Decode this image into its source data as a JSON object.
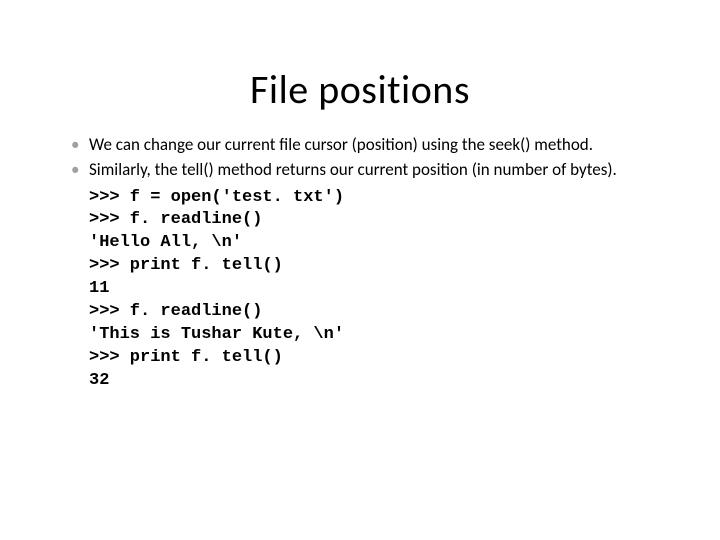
{
  "title": "File positions",
  "bullets": [
    "We can change our current file cursor (position) using the seek()  method.",
    "Similarly, the tell() method returns our current position (in number of  bytes)."
  ],
  "code_lines": [
    ">>> f = open('test. txt')",
    ">>> f. readline()",
    "'Hello All, \\n'",
    ">>> print f. tell()",
    "11",
    ">>> f. readline()",
    "'This is Tushar Kute, \\n'",
    ">>> print f. tell()",
    "32"
  ]
}
